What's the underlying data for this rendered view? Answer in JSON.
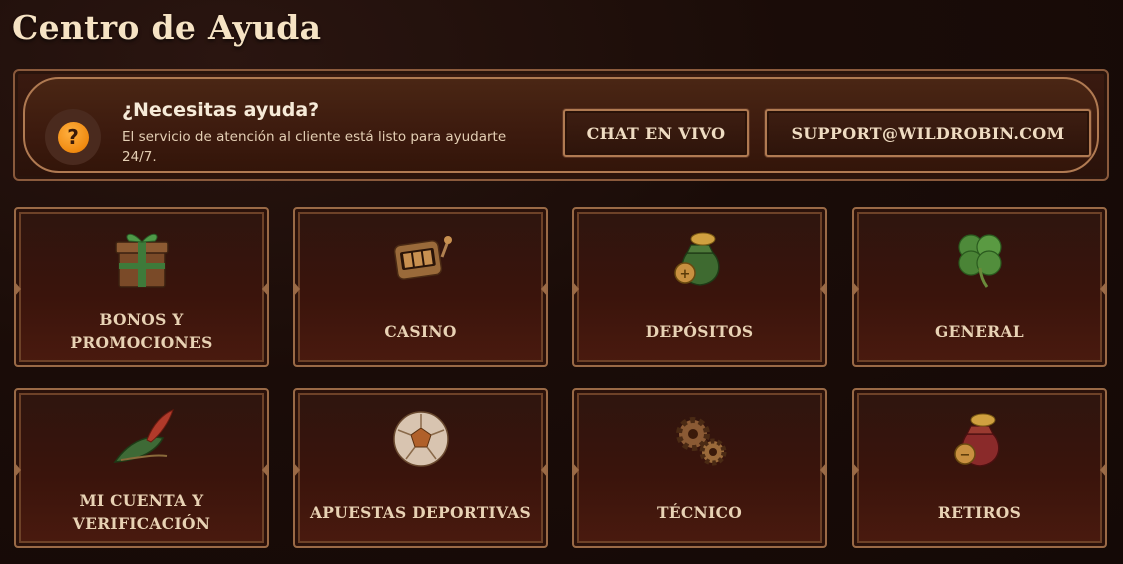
{
  "page": {
    "title": "Centro de Ayuda"
  },
  "help_banner": {
    "title": "¿Necesitas ayuda?",
    "text": "El servicio de atención al cliente está listo para ayudarte 24/7.",
    "icon": "question-circle-icon",
    "chat_label": "CHAT EN VIVO",
    "email_label": "SUPPORT@WILDROBIN.COM"
  },
  "categories": [
    {
      "label": "BONOS Y PROMOCIONES",
      "icon": "gift-box-icon"
    },
    {
      "label": "CASINO",
      "icon": "slot-machine-icon"
    },
    {
      "label": "DEPÓSITOS",
      "icon": "money-bag-icon"
    },
    {
      "label": "GENERAL",
      "icon": "clover-icon"
    },
    {
      "label": "MI CUENTA Y VERIFICACIÓN",
      "icon": "feathered-hat-icon"
    },
    {
      "label": "APUESTAS DEPORTIVAS",
      "icon": "football-icon"
    },
    {
      "label": "TÉCNICO",
      "icon": "gears-icon"
    },
    {
      "label": "RETIROS",
      "icon": "money-bag-red-icon"
    }
  ],
  "colors": {
    "background": "#1a0c08",
    "accent_border": "#b07a52",
    "help_icon": "#f08a10",
    "text": "#e8d2b4"
  }
}
